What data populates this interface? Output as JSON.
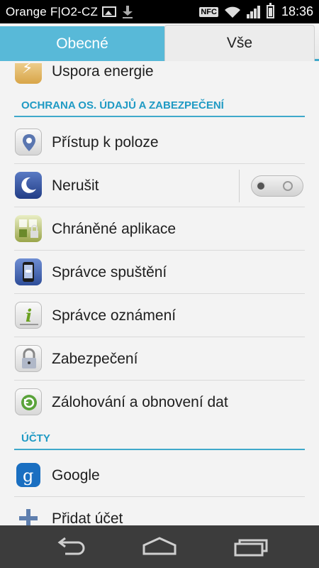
{
  "status_bar": {
    "carrier": "Orange F|O2-CZ",
    "nfc": "NFC",
    "time": "18:36",
    "icons": [
      "image-icon",
      "download-icon",
      "nfc-icon",
      "wifi-icon",
      "signal-icon",
      "battery-icon"
    ]
  },
  "tabs": [
    {
      "label": "Obecné",
      "selected": false
    },
    {
      "label": "Vše",
      "selected": true
    }
  ],
  "list": {
    "partial_top_item": "Uspora energie",
    "section_privacy": "OCHRANA OS. ÚDAJŮ A ZABEZPEČENÍ",
    "privacy_items": [
      {
        "label": "Přístup k poloze",
        "icon": "location-pin-icon"
      },
      {
        "label": "Nerušit",
        "icon": "moon-icon",
        "toggle": false
      },
      {
        "label": "Chráněné aplikace",
        "icon": "protected-apps-icon"
      },
      {
        "label": "Správce spuštění",
        "icon": "startup-manager-icon"
      },
      {
        "label": "Správce oznámení",
        "icon": "notification-manager-icon"
      },
      {
        "label": "Zabezpečení",
        "icon": "padlock-icon"
      },
      {
        "label": "Zálohování a obnovení dat",
        "icon": "backup-restore-icon"
      }
    ],
    "section_accounts": "ÚČTY",
    "account_items": [
      {
        "label": "Google",
        "icon": "google-icon"
      },
      {
        "label": "Přidat účet",
        "icon": "plus-icon"
      }
    ]
  },
  "nav_bar": {
    "icons": [
      "back-icon",
      "home-icon",
      "recent-apps-icon"
    ]
  },
  "colors": {
    "accent": "#3fa9cb",
    "section_text": "#1f9ac4",
    "tab_inactive_bg": "#58b9d8",
    "nav_bar_bg": "#3c3c3c"
  }
}
